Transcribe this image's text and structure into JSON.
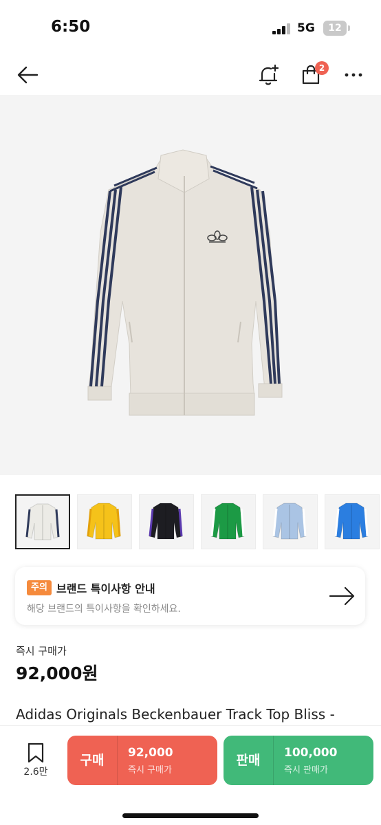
{
  "status_bar": {
    "time": "6:50",
    "network": "5G",
    "battery": "12"
  },
  "nav": {
    "back_icon": "arrow-left-icon",
    "alert_icon": "bell-plus-icon",
    "cart_icon": "shopping-bag-icon",
    "cart_count": "2",
    "more_icon": "more-horizontal-icon"
  },
  "product": {
    "hero_image": "cream track jacket with navy stripes",
    "thumbnails": [
      {
        "label": "cream",
        "color": "#ecebe6",
        "stripe": "#2f3a5b"
      },
      {
        "label": "yellow",
        "color": "#f5c21a",
        "stripe": "#e3a10c"
      },
      {
        "label": "black",
        "color": "#1d1d22",
        "stripe": "#5c3bb0"
      },
      {
        "label": "green",
        "color": "#1c9a45",
        "stripe": "#ffffff"
      },
      {
        "label": "light blue",
        "color": "#aac4e4",
        "stripe": "#ffffff"
      },
      {
        "label": "blue",
        "color": "#2b7ee0",
        "stripe": "#ffffff"
      }
    ],
    "selected_thumbnail": 0,
    "name": "Adidas Originals Beckenbauer Track Top Bliss -"
  },
  "notice": {
    "tag": "주의",
    "title": "브랜드 특이사항 안내",
    "subtitle": "해당 브랜드의 특이사항을 확인하세요.",
    "arrow_icon": "arrow-right-icon"
  },
  "price": {
    "label": "즉시 구매가",
    "value": "92,000원"
  },
  "bottom_bar": {
    "wish_icon": "bookmark-icon",
    "wish_count": "2.6만",
    "buy": {
      "label": "구매",
      "price": "92,000",
      "sub": "즉시 구매가",
      "color": "#ef6253"
    },
    "sell": {
      "label": "판매",
      "price": "100,000",
      "sub": "즉시 판매가",
      "color": "#41b979"
    }
  }
}
